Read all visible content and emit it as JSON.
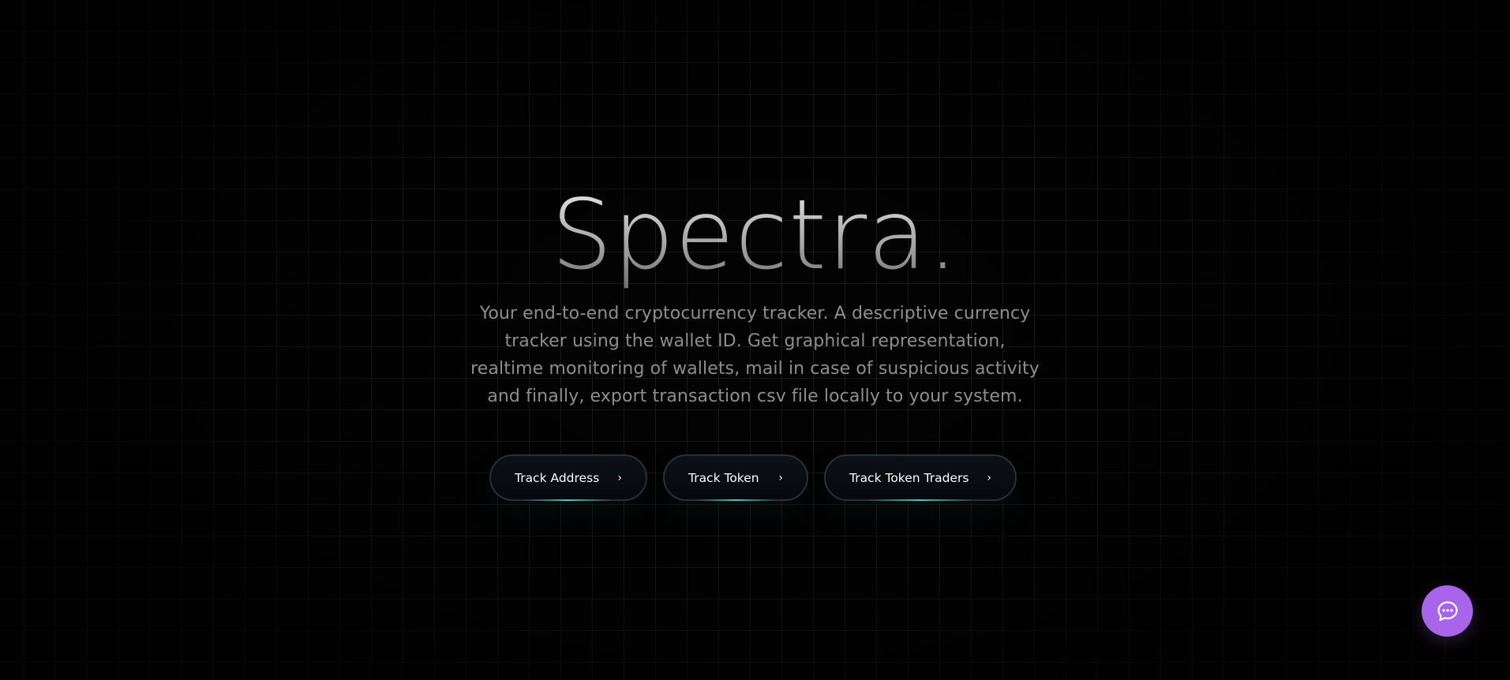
{
  "hero": {
    "title": "Spectra.",
    "description": "Your end-to-end cryptocurrency tracker. A descriptive currency tracker using the wallet ID. Get graphical representation, realtime monitoring of wallets, mail in case of suspicious activity and finally, export transaction csv file locally to your system."
  },
  "actions": [
    {
      "label": "Track Address",
      "icon": "chevron-right-icon",
      "chevron": "›"
    },
    {
      "label": "Track Token",
      "icon": "chevron-right-icon",
      "chevron": "›"
    },
    {
      "label": "Track Token Traders",
      "icon": "chevron-right-icon",
      "chevron": "›"
    }
  ],
  "chat": {
    "icon": "chat-bubble-icon",
    "color": "#a865ea"
  },
  "theme": {
    "background": "#030303",
    "button_border": "#29303b",
    "button_glow": "#46dcd2",
    "description_color": "#8e8e8e"
  }
}
